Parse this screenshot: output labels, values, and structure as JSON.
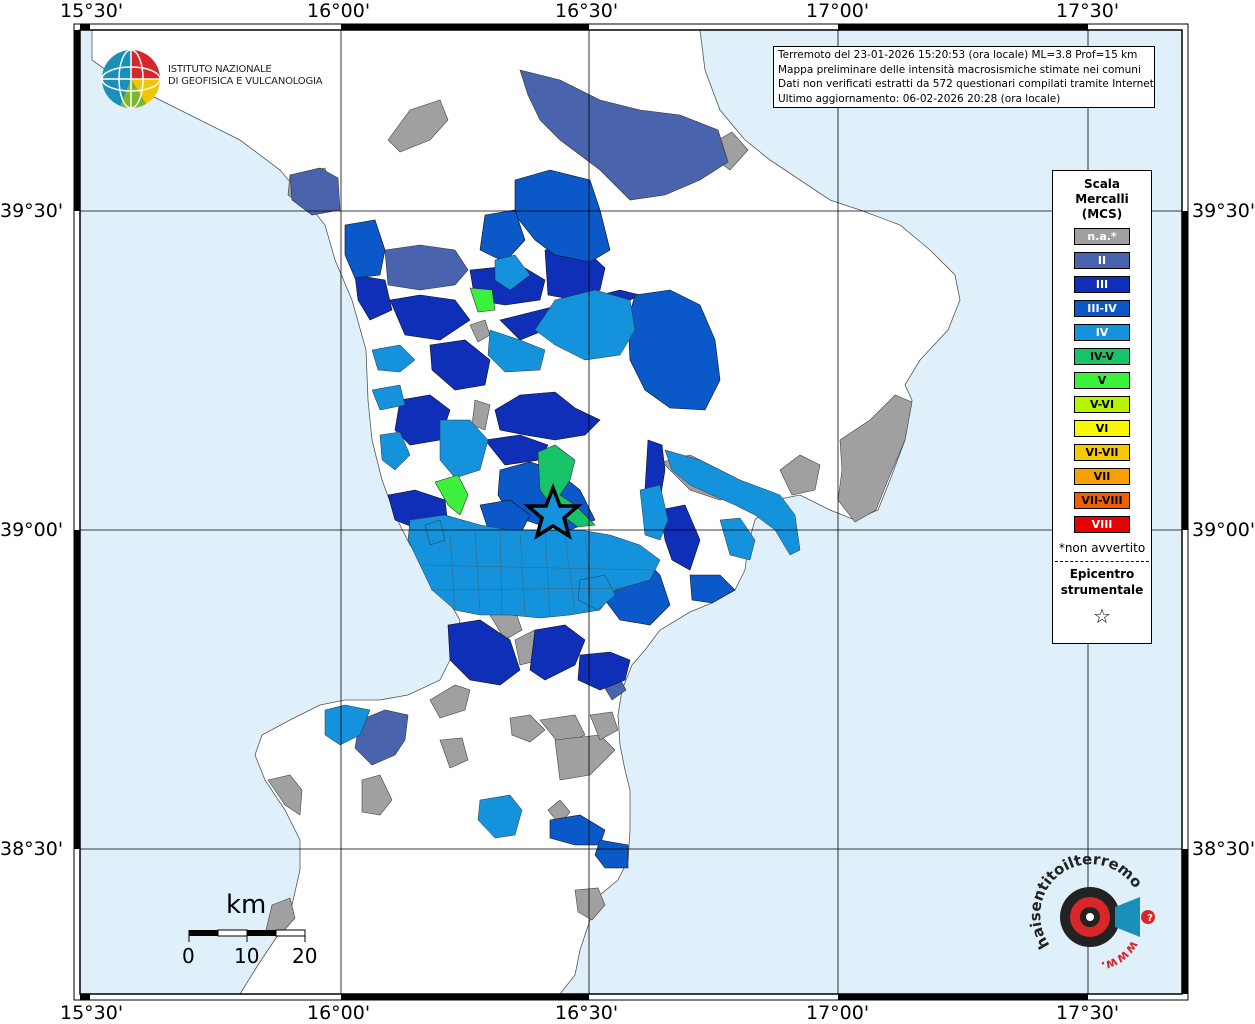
{
  "lon_ticks": [
    "15°30'",
    "16°00'",
    "16°30'",
    "17°00'",
    "17°30'"
  ],
  "lat_ticks": [
    "39°30'",
    "39°00'",
    "38°30'"
  ],
  "logo": {
    "line1": "ISTITUTO NAZIONALE",
    "line2": "DI GEOFISICA E VULCANOLOGIA"
  },
  "info_box": [
    "Terremoto del 23-01-2026 15:20:53 (ora locale) ML=3.8 Prof=15 km",
    "Mappa preliminare delle intensità macrosismiche stimate nei comuni",
    "Dati non verificati estratti da 572 questionari compilati tramite Internet.",
    "Ultimo aggiornamento: 06-02-2026 20:28 (ora locale)"
  ],
  "legend": {
    "title_line1": "Scala",
    "title_line2": "Mercalli",
    "title_line3": "(MCS)",
    "items": [
      {
        "label": "n.a.*",
        "color": "#a0a0a0",
        "text_color": "#ffffff"
      },
      {
        "label": "II",
        "color": "#4a63ad",
        "text_color": "#ffffff"
      },
      {
        "label": "III",
        "color": "#0f2fb8",
        "text_color": "#ffffff"
      },
      {
        "label": "III-IV",
        "color": "#0b59c8",
        "text_color": "#ffffff"
      },
      {
        "label": "IV",
        "color": "#1493dc",
        "text_color": "#ffffff"
      },
      {
        "label": "IV-V",
        "color": "#18c46a",
        "text_color": "#000000"
      },
      {
        "label": "V",
        "color": "#3cf03c",
        "text_color": "#000000"
      },
      {
        "label": "V-VI",
        "color": "#b8f400",
        "text_color": "#000000"
      },
      {
        "label": "VI",
        "color": "#f8f800",
        "text_color": "#000000"
      },
      {
        "label": "VI-VII",
        "color": "#f8c800",
        "text_color": "#000000"
      },
      {
        "label": "VII",
        "color": "#f8a000",
        "text_color": "#000000"
      },
      {
        "label": "VII-VIII",
        "color": "#f06000",
        "text_color": "#000000"
      },
      {
        "label": "VIII",
        "color": "#e80000",
        "text_color": "#ffffff"
      }
    ],
    "note": "*non avvertito",
    "epicentre_line1": "Epicentro",
    "epicentre_line2": "strumentale",
    "star": "☆"
  },
  "scale_bar": {
    "unit": "km",
    "labels": [
      "0",
      "10",
      "20"
    ]
  },
  "hsl": {
    "brand": "haisentitoilterremoto.it",
    "www": "www."
  },
  "colors": {
    "sea": "#e0f0fa",
    "land": "#ffffff",
    "grid": "#000000"
  }
}
